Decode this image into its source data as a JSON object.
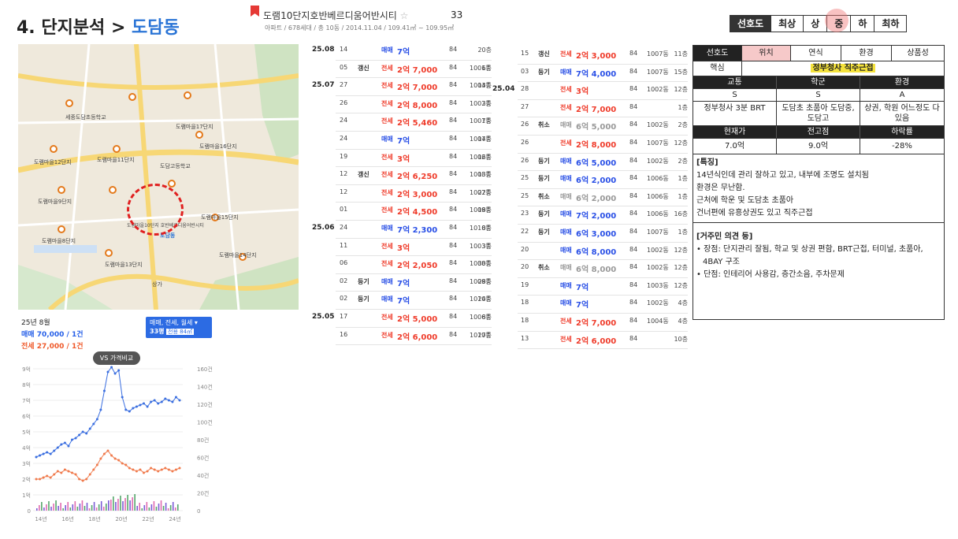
{
  "header": {
    "section": "4. 단지분석 > ",
    "dong": "도담동",
    "complex_name": "도램10단지호반베르디움어반시티",
    "star": "☆",
    "count": "33",
    "complex_sub": "아파트 / 678세대 / 총 10동 / 2014.11.04 / 109.41㎡ ~ 109.95㎡"
  },
  "grade": {
    "items": [
      "선호도",
      "최상",
      "상",
      "중",
      "하",
      "최하"
    ],
    "selected": "중"
  },
  "map": {
    "labels": [
      "도담동",
      "도램마을11단지",
      "도램마을15단지",
      "도램마을10단지 호반베르디움어반시티",
      "도램마을14단지",
      "도램마을17단지",
      "세종도담초등학교",
      "도담고등학교",
      "도램마을9단지",
      "도램마을12단지",
      "도램마을16단지",
      "도램마을8단지",
      "도램마을13단지",
      "상가"
    ]
  },
  "chart_info": {
    "period": "25년 8월",
    "sale": "매매 70,000 / 1건",
    "jeonse": "전세 27,000 / 1건",
    "filter": "매매, 전세, 월세",
    "size": "33평",
    "area": "전용 84㎡",
    "compare": "VS 가격비교"
  },
  "chart_data": {
    "type": "line",
    "x": [
      "14년",
      "16년",
      "18년",
      "20년",
      "22년",
      "24년"
    ],
    "y_left_ticks": [
      "0",
      "1억",
      "2억",
      "3억",
      "4억",
      "5억",
      "6억",
      "7억",
      "8억",
      "9억"
    ],
    "y_right_ticks": [
      "0",
      "20건",
      "40건",
      "60건",
      "80건",
      "100건",
      "120건",
      "140건",
      "160건"
    ],
    "series": [
      {
        "name": "매매",
        "color": "#3b6fe0",
        "values": [
          3.4,
          3.5,
          3.6,
          3.7,
          3.6,
          3.8,
          4.0,
          4.2,
          4.3,
          4.1,
          4.5,
          4.6,
          4.8,
          5.0,
          4.9,
          5.2,
          5.5,
          5.8,
          6.4,
          7.6,
          8.8,
          9.1,
          8.7,
          8.9,
          7.2,
          6.4,
          6.3,
          6.5,
          6.6,
          6.7,
          6.8,
          6.6,
          6.9,
          7.0,
          6.8,
          6.9,
          7.1,
          7.0,
          6.9,
          7.2,
          7.0
        ]
      },
      {
        "name": "전세",
        "color": "#f07a4c",
        "values": [
          2.0,
          2.0,
          2.1,
          2.2,
          2.1,
          2.3,
          2.5,
          2.4,
          2.6,
          2.5,
          2.4,
          2.3,
          2.0,
          1.9,
          2.0,
          2.3,
          2.6,
          2.9,
          3.3,
          3.6,
          3.8,
          3.5,
          3.3,
          3.2,
          3.0,
          2.9,
          2.7,
          2.6,
          2.5,
          2.6,
          2.4,
          2.5,
          2.7,
          2.6,
          2.5,
          2.6,
          2.7,
          2.6,
          2.5,
          2.6,
          2.7
        ]
      }
    ]
  },
  "left_list": [
    {
      "period": "25.08",
      "day": "14",
      "flag": "",
      "type": "매매",
      "price": "7억",
      "area": "84",
      "bldg": "",
      "floor": "20층",
      "color": "bl"
    },
    {
      "period": "",
      "day": "05",
      "flag": "갱신",
      "type": "전세",
      "price": "2억 7,000",
      "area": "84",
      "bldg": "1001동",
      "floor": "6층",
      "color": "rd"
    },
    {
      "period": "25.07",
      "day": "27",
      "flag": "",
      "type": "전세",
      "price": "2억 7,000",
      "area": "84",
      "bldg": "1004동",
      "floor": "13층",
      "color": "rd"
    },
    {
      "period": "",
      "day": "26",
      "flag": "",
      "type": "전세",
      "price": "2억 8,000",
      "area": "84",
      "bldg": "1002동",
      "floor": "3층",
      "color": "rd"
    },
    {
      "period": "",
      "day": "24",
      "flag": "",
      "type": "전세",
      "price": "2억 5,460",
      "area": "84",
      "bldg": "1001동",
      "floor": "7층",
      "color": "rd"
    },
    {
      "period": "",
      "day": "24",
      "flag": "",
      "type": "매매",
      "price": "7억",
      "area": "84",
      "bldg": "1007동",
      "floor": "14층",
      "color": "bl"
    },
    {
      "period": "",
      "day": "19",
      "flag": "",
      "type": "전세",
      "price": "3억",
      "area": "84",
      "bldg": "1002동",
      "floor": "16층",
      "color": "rd"
    },
    {
      "period": "",
      "day": "12",
      "flag": "갱신",
      "type": "전세",
      "price": "2억 6,250",
      "area": "84",
      "bldg": "1008동",
      "floor": "13층",
      "color": "rd"
    },
    {
      "period": "",
      "day": "12",
      "flag": "",
      "type": "전세",
      "price": "2억 3,000",
      "area": "84",
      "bldg": "1007동",
      "floor": "22층",
      "color": "rd"
    },
    {
      "period": "",
      "day": "01",
      "flag": "",
      "type": "전세",
      "price": "2억 4,500",
      "area": "84",
      "bldg": "1009동",
      "floor": "18층",
      "color": "rd"
    },
    {
      "period": "25.06",
      "day": "24",
      "flag": "",
      "type": "매매",
      "price": "7억 2,300",
      "area": "84",
      "bldg": "1010동",
      "floor": "8층",
      "color": "bl"
    },
    {
      "period": "",
      "day": "11",
      "flag": "",
      "type": "전세",
      "price": "3억",
      "area": "84",
      "bldg": "1003동",
      "floor": "3층",
      "color": "rd"
    },
    {
      "period": "",
      "day": "06",
      "flag": "",
      "type": "전세",
      "price": "2억 2,050",
      "area": "84",
      "bldg": "1008동",
      "floor": "30층",
      "color": "rd"
    },
    {
      "period": "",
      "day": "02",
      "flag": "등기",
      "type": "매매",
      "price": "7억",
      "area": "84",
      "bldg": "1009동",
      "floor": "28층",
      "color": "bl"
    },
    {
      "period": "",
      "day": "02",
      "flag": "등기",
      "type": "매매",
      "price": "7억",
      "area": "84",
      "bldg": "1010동",
      "floor": "24층",
      "color": "bl"
    },
    {
      "period": "25.05",
      "day": "17",
      "flag": "",
      "type": "전세",
      "price": "2억 5,000",
      "area": "84",
      "bldg": "1006동",
      "floor": "8층",
      "color": "rd"
    },
    {
      "period": "",
      "day": "16",
      "flag": "",
      "type": "전세",
      "price": "2억 6,000",
      "area": "84",
      "bldg": "1010동",
      "floor": "27층",
      "color": "rd"
    }
  ],
  "right_list": [
    {
      "period": "",
      "day": "15",
      "flag": "갱신",
      "type": "전세",
      "price": "2억 3,000",
      "area": "84",
      "bldg": "1007동",
      "floor": "11층",
      "color": "rd"
    },
    {
      "period": "",
      "day": "03",
      "flag": "등기",
      "type": "매매",
      "price": "7억 4,000",
      "area": "84",
      "bldg": "1007동",
      "floor": "15층",
      "color": "bl"
    },
    {
      "period": "25.04",
      "day": "28",
      "flag": "",
      "type": "전세",
      "price": "3억",
      "area": "84",
      "bldg": "1002동",
      "floor": "12층",
      "color": "rd"
    },
    {
      "period": "",
      "day": "27",
      "flag": "",
      "type": "전세",
      "price": "2억 7,000",
      "area": "84",
      "bldg": "",
      "floor": "1층",
      "color": "rd"
    },
    {
      "period": "",
      "day": "26",
      "flag": "취소",
      "type": "매매",
      "price": "6억 5,000",
      "area": "84",
      "bldg": "1002동",
      "floor": "2층",
      "color": "gy"
    },
    {
      "period": "",
      "day": "26",
      "flag": "",
      "type": "전세",
      "price": "2억 8,000",
      "area": "84",
      "bldg": "1007동",
      "floor": "12층",
      "color": "rd"
    },
    {
      "period": "",
      "day": "26",
      "flag": "등기",
      "type": "매매",
      "price": "6억 5,000",
      "area": "84",
      "bldg": "1002동",
      "floor": "2층",
      "color": "bl"
    },
    {
      "period": "",
      "day": "25",
      "flag": "등기",
      "type": "매매",
      "price": "6억 2,000",
      "area": "84",
      "bldg": "1006동",
      "floor": "1층",
      "color": "bl"
    },
    {
      "period": "",
      "day": "25",
      "flag": "취소",
      "type": "매매",
      "price": "6억 2,000",
      "area": "84",
      "bldg": "1006동",
      "floor": "1층",
      "color": "gy"
    },
    {
      "period": "",
      "day": "23",
      "flag": "등기",
      "type": "매매",
      "price": "7억 2,000",
      "area": "84",
      "bldg": "1006동",
      "floor": "16층",
      "color": "bl"
    },
    {
      "period": "",
      "day": "22",
      "flag": "등기",
      "type": "매매",
      "price": "6억 3,000",
      "area": "84",
      "bldg": "1007동",
      "floor": "1층",
      "color": "bl"
    },
    {
      "period": "",
      "day": "20",
      "flag": "",
      "type": "매매",
      "price": "6억 8,000",
      "area": "84",
      "bldg": "1002동",
      "floor": "12층",
      "color": "bl"
    },
    {
      "period": "",
      "day": "20",
      "flag": "취소",
      "type": "매매",
      "price": "6억 8,000",
      "area": "84",
      "bldg": "1002동",
      "floor": "12층",
      "color": "gy"
    },
    {
      "period": "",
      "day": "19",
      "flag": "",
      "type": "매매",
      "price": "7억",
      "area": "84",
      "bldg": "1003동",
      "floor": "12층",
      "color": "bl"
    },
    {
      "period": "",
      "day": "18",
      "flag": "",
      "type": "매매",
      "price": "7억",
      "area": "84",
      "bldg": "1002동",
      "floor": "4층",
      "color": "bl"
    },
    {
      "period": "",
      "day": "18",
      "flag": "",
      "type": "전세",
      "price": "2억 7,000",
      "area": "84",
      "bldg": "1004동",
      "floor": "4층",
      "color": "rd"
    },
    {
      "period": "",
      "day": "13",
      "flag": "",
      "type": "전세",
      "price": "2억 6,000",
      "area": "84",
      "bldg": "",
      "floor": "10층",
      "color": "rd"
    }
  ],
  "panel": {
    "tabs": [
      "선호도",
      "위치",
      "연식",
      "환경",
      "상품성"
    ],
    "core_label": "핵심",
    "core_value": "정부청사 직주근접",
    "cat_headers": [
      "교통",
      "학군",
      "환경"
    ],
    "grades": [
      "S",
      "S",
      "A"
    ],
    "details": [
      "정부청사 3분 BRT",
      "도담초 초품아 도담중, 도담고",
      "상권, 학원 어느정도 다 있음"
    ],
    "price_headers": [
      "현재가",
      "전고점",
      "하락률"
    ],
    "prices": [
      "7.0억",
      "9.0억",
      "-28%"
    ],
    "feature_title": "[특징]",
    "features": [
      "14년식인데 관리 잘하고 있고, 내부에 조명도 설치됨",
      "환경은 무난함.",
      "근처에 학운 및 도담초 초품아",
      "건너편에 유흥상권도 있고 직주근접"
    ],
    "opinion_title": "[거주민 의견 등]",
    "opinions": [
      "• 장점: 단지관리 잘됨, 학교 및 상권 편함, BRT근접, 터미널, 초품아, 4BAY 구조",
      "• 단점: 인테리어 사용감, 층간소음, 주차문제"
    ]
  }
}
